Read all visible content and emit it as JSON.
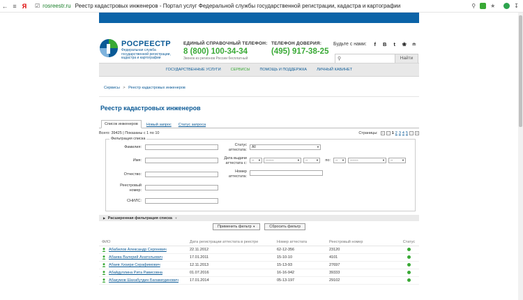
{
  "browser": {
    "yandex_letter": "Я",
    "domain": "rosreestr.ru",
    "title": "Реестр кадастровых инженеров - Портал услуг Федеральной службы государственной регистрации, кадастра и картографии"
  },
  "header": {
    "brand": "РОСРЕЕСТР",
    "brand_sub": "Федеральная служба государственной регистрации, кадастра и картографии",
    "phone1_label": "ЕДИНЫЙ СПРАВОЧНЫЙ ТЕЛЕФОН:",
    "phone1_number": "8 (800) 100-34-34",
    "phone1_note": "Звонок из регионов России бесплатный",
    "phone2_label": "ТЕЛЕФОН ДОВЕРИЯ:",
    "phone2_number": "(495) 917-38-25",
    "social_label": "Будьте с нами:",
    "social_icons": [
      "f",
      "В",
      "t",
      "ok",
      "rss"
    ],
    "search_button": "Найти"
  },
  "nav": {
    "items": [
      "ГОСУДАРСТВЕННЫЕ УСЛУГИ",
      "СЕРВИСЫ",
      "ПОМОЩЬ И ПОДДЕРЖКА",
      "ЛИЧНЫЙ КАБИНЕТ"
    ]
  },
  "breadcrumb": {
    "first": "Сервисы",
    "sep": ">",
    "current": "Реестр кадастровых инженеров"
  },
  "page_title": "Реестр кадастровых инженеров",
  "tabs": [
    "Список инженеров",
    "Новый запрос",
    "Статус запроса"
  ],
  "meta": {
    "total": "Всего: 39425 | Показаны с 1 по 10",
    "pages_label": "Страницы:",
    "pages": [
      "1",
      "2",
      "3",
      "4",
      "5"
    ],
    "current_page": "1"
  },
  "filter": {
    "legend": "Фильтрация списка",
    "surname": "Фамилия:",
    "name": "Имя:",
    "patronymic": "Отчество:",
    "reg_number": "Реестровый номер:",
    "snils": "СНИЛС:",
    "status_label": "Статус аттестата:",
    "status_value": "All",
    "date_label": "Дата выдачи аттестата с:",
    "date_to": "по:",
    "dash": "--",
    "dashes": "-------",
    "number_label": "Номер аттестата:"
  },
  "extended": "Расширенная фильтрация списка",
  "buttons": {
    "apply": "Применить фильтр",
    "reset": "Сбросить фильтр"
  },
  "table": {
    "headers": [
      "ФИО",
      "Дата регистрации аттестата в реестре",
      "Номер аттестата",
      "Реестровый номер",
      "Статус"
    ],
    "rows": [
      [
        "Абабилов Александр Сергеевич",
        "22.11.2012",
        "62-12-356",
        "23120"
      ],
      [
        "Абаева Валерий Анатольевич",
        "17.01.2011",
        "15-10-10",
        "4101"
      ],
      [
        "Абаев Хизири Серафимович",
        "12.11.2013",
        "15-13-93",
        "27697"
      ],
      [
        "Абайдуллина Рита Рависовна",
        "01.07.2016",
        "16-16-942",
        "39333"
      ],
      [
        "Абакумов Шахабутдин Багаватдинович",
        "17.01.2014",
        "05-13-197",
        "29102"
      ]
    ]
  },
  "colors": {
    "brand_blue": "#0b5a96",
    "green": "#39a935",
    "topbar": "#0b63a8"
  }
}
